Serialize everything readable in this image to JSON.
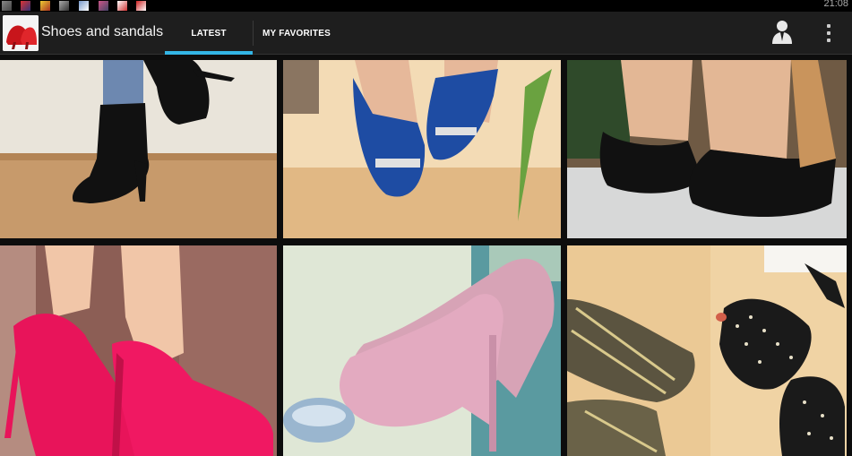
{
  "status_bar": {
    "time": "21:08",
    "notification_icons": [
      "notification-thumb-icon",
      "notification-thumb-icon",
      "notification-thumb-icon",
      "notification-thumb-icon",
      "notification-thumb-icon",
      "notification-thumb-icon",
      "notification-thumb-icon",
      "notification-thumb-icon"
    ]
  },
  "action_bar": {
    "app_icon": "red-high-heel-icon",
    "title": "Shoes and sandals",
    "tabs": [
      {
        "label": "LATEST",
        "selected": true
      },
      {
        "label": "MY FAVORITES",
        "selected": false
      }
    ],
    "profile_icon": "person-icon",
    "overflow_icon": "overflow-menu-icon",
    "accent_color": "#33b5e5"
  },
  "gallery": {
    "items": [
      {
        "name": "black-ankle-boot-photo"
      },
      {
        "name": "blue-peep-toe-flats-photo"
      },
      {
        "name": "black-wedge-sandals-photo"
      },
      {
        "name": "pink-suede-pumps-photo"
      },
      {
        "name": "pink-glitter-platform-heels-photo"
      },
      {
        "name": "zebra-studded-heels-photo"
      }
    ]
  }
}
